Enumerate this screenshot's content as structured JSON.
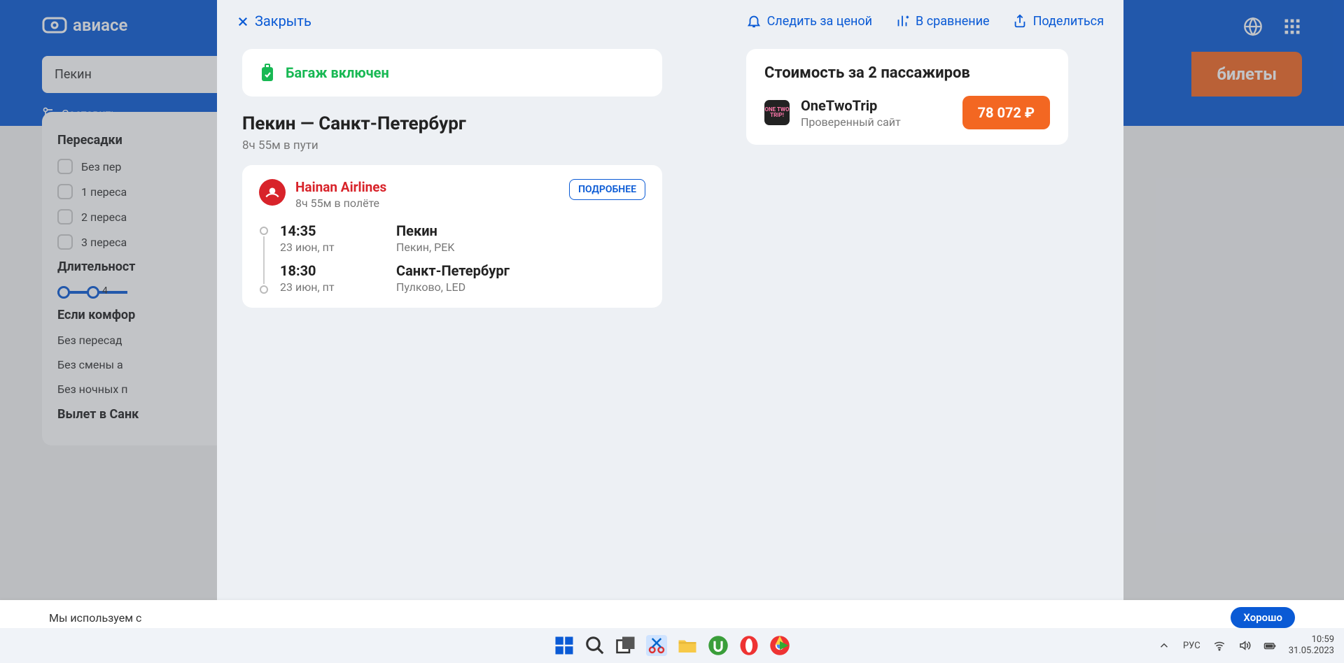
{
  "bg": {
    "logo": "авиасе",
    "search_from": "Пекин",
    "search_btn": "билеты",
    "compose": "Составить"
  },
  "sidebar": {
    "title_transfers": "Пересадки",
    "cb0": "Без пер",
    "cb1": "1 переса",
    "cb2": "2 переса",
    "cb3": "3 переса",
    "title_duration": "Длительност",
    "slider_val": "4",
    "title_comfort": "Если комфор",
    "opt0": "Без пересад",
    "opt1": "Без смены а",
    "opt2": "Без ночных п",
    "title_depart": "Вылет в Санк"
  },
  "modal": {
    "close": "Закрыть",
    "follow": "Следить за ценой",
    "compare": "В сравнение",
    "share": "Поделиться",
    "baggage": "Багаж включен",
    "route": "Пекин — Санкт-Петербург",
    "route_duration": "8ч 55м в пути",
    "airline": "Hainan Airlines",
    "flight_duration": "8ч 55м в полёте",
    "details_btn": "ПОДРОБНЕЕ",
    "dep_time": "14:35",
    "dep_date": "23 июн, пт",
    "dep_city": "Пекин",
    "dep_airport": "Пекин, PEK",
    "arr_time": "18:30",
    "arr_date": "23 июн, пт",
    "arr_city": "Санкт-Петербург",
    "arr_airport": "Пулково, LED",
    "price_title": "Стоимость за 2 пассажиров",
    "agent_name": "OneTwoTrip",
    "agent_sub": "Проверенный сайт",
    "agent_logo_text": "ONE TWO TRIP!",
    "price": "78 072 ₽"
  },
  "cookie": {
    "text": "Мы используем с",
    "btn": "Хорошо"
  },
  "taskbar": {
    "lang": "РУС",
    "time": "10:59",
    "date": "31.05.2023"
  }
}
